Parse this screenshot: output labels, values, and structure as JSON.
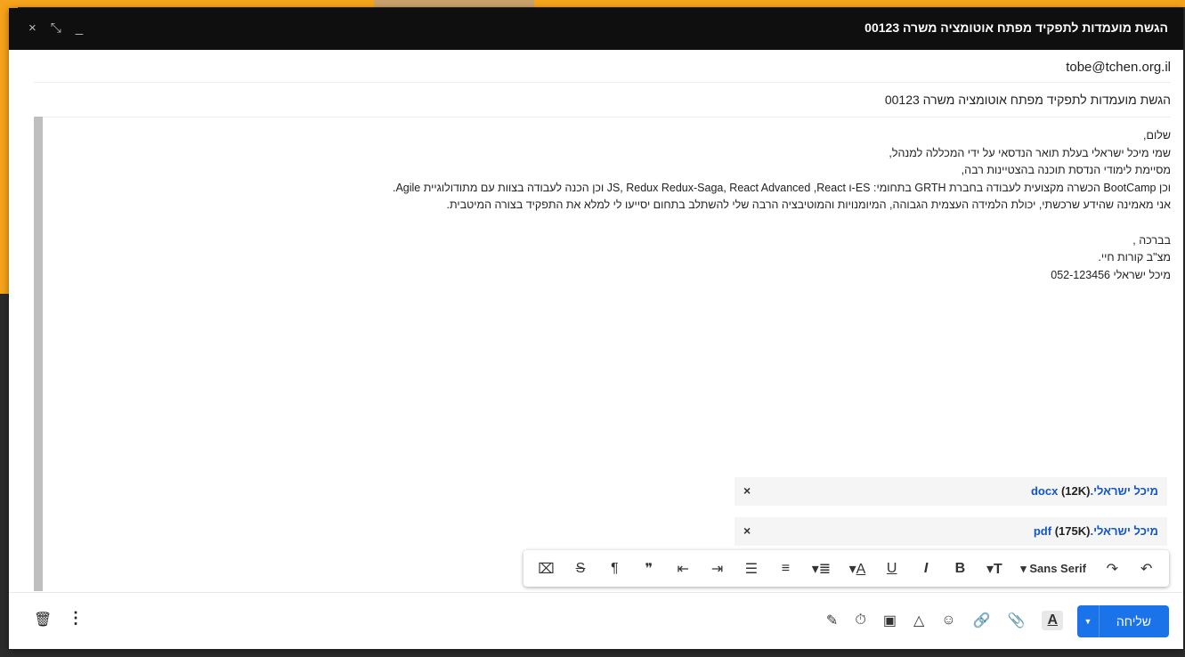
{
  "window": {
    "title": "הגשת מועמדות לתפקיד מפתח אוטומציה משרה 00123",
    "controls": [
      "×",
      "⤡",
      "_"
    ]
  },
  "compose": {
    "to": "tobe@tchen.org.il",
    "subject": "הגשת מועמדות לתפקיד מפתח אוטומציה משרה 00123",
    "body": [
      "שלום,",
      "שמי מיכל ישראלי בעלת תואר הנדסאי על ידי המכללה למנהל,",
      "מסיימת לימודי הנדסת תוכנה בהצטיינות רבה,",
      "וכן BootCamp הכשרה מקצועית לעבודה בחברת GRTH בתחומי: ES-ו JS, Redux Redux-Saga, React Advanced ,React וכן הכנה לעבודה בצוות עם מתודולוגיית Agile.",
      "אני מאמינה שהידע שרכשתי, יכולת הלמידה העצמית הגבוהה, המיומנויות והמוטיבציה הרבה שלי להשתלב בתחום יסייעו לי למלא את התפקיד בצורה המיטבית.",
      "",
      "בברכה ,",
      "מצ\"ב קורות חיי.",
      "מיכל ישראלי 052-123456"
    ],
    "attachments": [
      {
        "name": "מיכל ישראלי.docx",
        "size": "(12K)"
      },
      {
        "name": "מיכל ישראלי.pdf",
        "size": "(175K)"
      }
    ],
    "remove_symbol": "×"
  },
  "format_toolbar": {
    "font": "Sans Serif",
    "icons": [
      "clear-formatting",
      "strikethrough",
      "rtl-paragraph",
      "quote",
      "indent-less",
      "indent-more",
      "bulleted-list",
      "numbered-list",
      "align",
      "text-color",
      "underline",
      "italic",
      "bold",
      "font-size",
      "font-family",
      "redo",
      "undo"
    ]
  },
  "bottom": {
    "send_label": "שליחה",
    "colors": {
      "send": "#1a73e8",
      "titlebar": "#0f0f0f",
      "accent_frame": "#f5a31a"
    }
  }
}
